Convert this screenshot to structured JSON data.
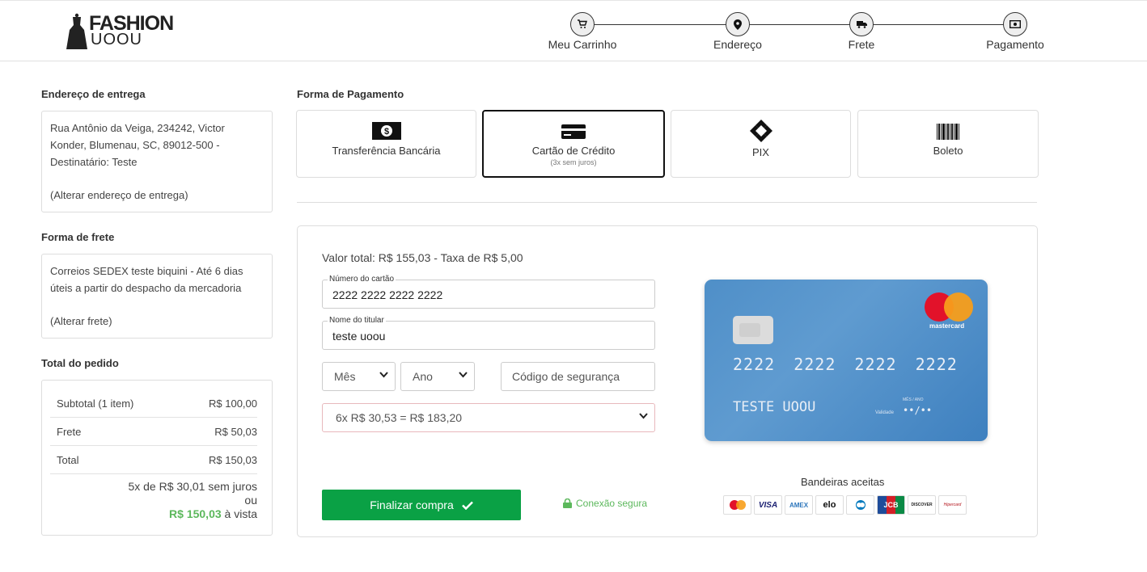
{
  "header": {
    "logo_line1": "FASHION",
    "logo_line2": "UOOU",
    "steps": [
      {
        "label": "Meu Carrinho",
        "icon": "cart-icon"
      },
      {
        "label": "Endereço",
        "icon": "map-pin-icon"
      },
      {
        "label": "Frete",
        "icon": "truck-icon"
      },
      {
        "label": "Pagamento",
        "icon": "money-icon"
      }
    ]
  },
  "sidebar": {
    "address_title": "Endereço de entrega",
    "address_text": "Rua Antônio da Veiga, 234242, Victor Konder, Blumenau, SC, 89012-500 - Destinatário: Teste",
    "address_change": "(Alterar endereço de entrega)",
    "shipping_title": "Forma de frete",
    "shipping_text": "Correios SEDEX teste biquini - Até 6 dias úteis a partir do despacho da mercadoria",
    "shipping_change": "(Alterar frete)",
    "totals_title": "Total do pedido",
    "totals": [
      {
        "label": "Subtotal (1 item)",
        "value": "R$ 100,00"
      },
      {
        "label": "Frete",
        "value": "R$ 50,03"
      },
      {
        "label": "Total",
        "value": "R$ 150,03"
      }
    ],
    "installments_text": "5x de R$ 30,01 sem juros",
    "or_text": "ou",
    "cash_price": "R$ 150,03",
    "cash_suffix": "à vista"
  },
  "payment": {
    "title": "Forma de Pagamento",
    "methods": [
      {
        "label": "Transferência Bancária",
        "sub": "",
        "active": false
      },
      {
        "label": "Cartão de Crédito",
        "sub": "(3x sem juros)",
        "active": true
      },
      {
        "label": "PIX",
        "sub": "",
        "active": false
      },
      {
        "label": "Boleto",
        "sub": "",
        "active": false
      }
    ]
  },
  "form": {
    "total_text": "Valor total: R$ 155,03 - Taxa de R$ 5,00",
    "card_number_label": "Número do cartão",
    "card_number_value": "2222 2222 2222 2222",
    "holder_label": "Nome do titular",
    "holder_value": "teste uoou",
    "month_select": "Mês",
    "year_select": "Ano",
    "cvv_placeholder": "Código de segurança",
    "installment_select": "6x R$ 30,53 = R$ 183,20",
    "submit_label": "Finalizar compra",
    "secure_label": "Conexão segura"
  },
  "card_preview": {
    "brand_word": "mastercard",
    "number": "2222 2222 2222 2222",
    "holder": "TESTE UOOU",
    "mes_ano_label": "MÊS / ANO",
    "validade_label": "Validade",
    "expiry": "••/••"
  },
  "brands": {
    "title": "Bandeiras aceitas",
    "list": [
      "mastercard",
      "VISA",
      "AMEX",
      "elo",
      "diners",
      "JCB",
      "DISCOVER",
      "Hipercard"
    ]
  },
  "colors": {
    "accent_green": "#0aa145",
    "price_green": "#5cb85c",
    "card_blue": "#4f8fc8"
  }
}
